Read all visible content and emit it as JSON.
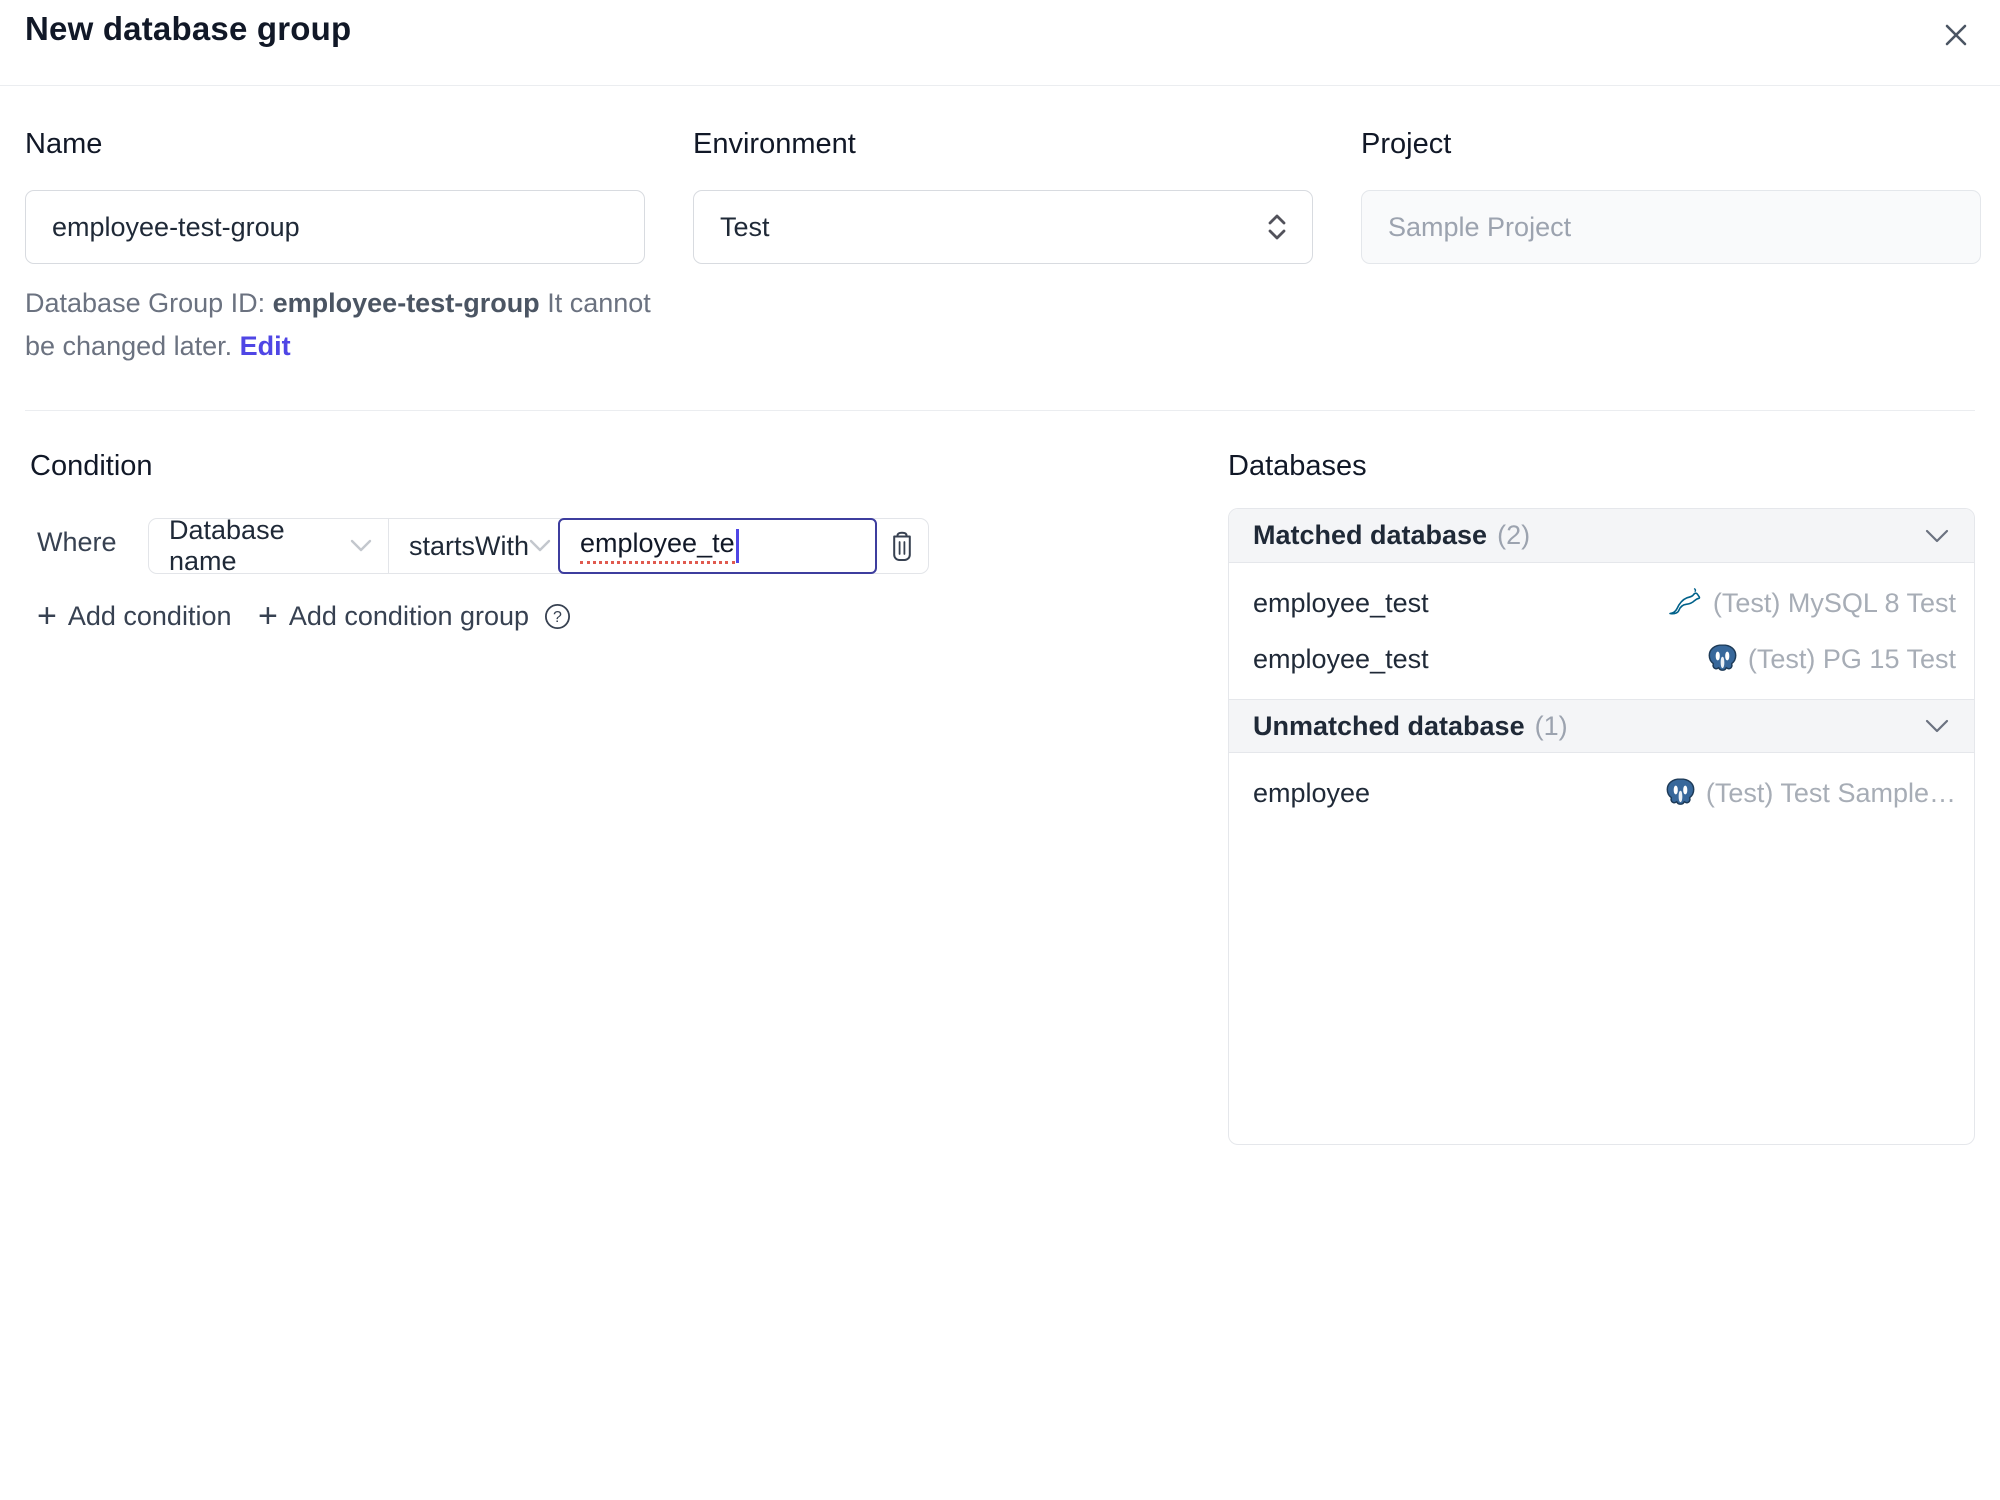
{
  "dialog": {
    "title": "New database group"
  },
  "form": {
    "name": {
      "label": "Name",
      "value": "employee-test-group"
    },
    "environment": {
      "label": "Environment",
      "value": "Test"
    },
    "project": {
      "label": "Project",
      "value": "Sample Project"
    },
    "id_hint": {
      "prefix": "Database Group ID: ",
      "id": "employee-test-group",
      "suffix": " It cannot be changed later. ",
      "edit_label": "Edit"
    }
  },
  "condition": {
    "heading": "Condition",
    "where_label": "Where",
    "field_selected": "Database name",
    "operator_selected": "startsWith",
    "value": "employee_te",
    "add_condition_label": "Add condition",
    "add_condition_group_label": "Add condition group"
  },
  "databases": {
    "heading": "Databases",
    "groups": [
      {
        "title": "Matched database",
        "count": "(2)",
        "rows": [
          {
            "name": "employee_test",
            "engine": "mysql",
            "instance": "(Test) MySQL 8 Test"
          },
          {
            "name": "employee_test",
            "engine": "postgres",
            "instance": "(Test) PG 15 Test"
          }
        ]
      },
      {
        "title": "Unmatched database",
        "count": "(1)",
        "rows": [
          {
            "name": "employee",
            "engine": "postgres",
            "instance": "(Test) Test Sample…"
          }
        ]
      }
    ]
  },
  "icons": {
    "plus": "+",
    "help": "?"
  },
  "colors": {
    "accent": "#4f46e5",
    "focus_border": "#3d3d9e",
    "spellcheck_red": "#e05a4f",
    "mysql_brand": "#00618a",
    "postgres_brand": "#38689b",
    "header_bg": "#f4f5f7",
    "border": "#e5e7eb",
    "text_muted": "#9ca3af"
  }
}
